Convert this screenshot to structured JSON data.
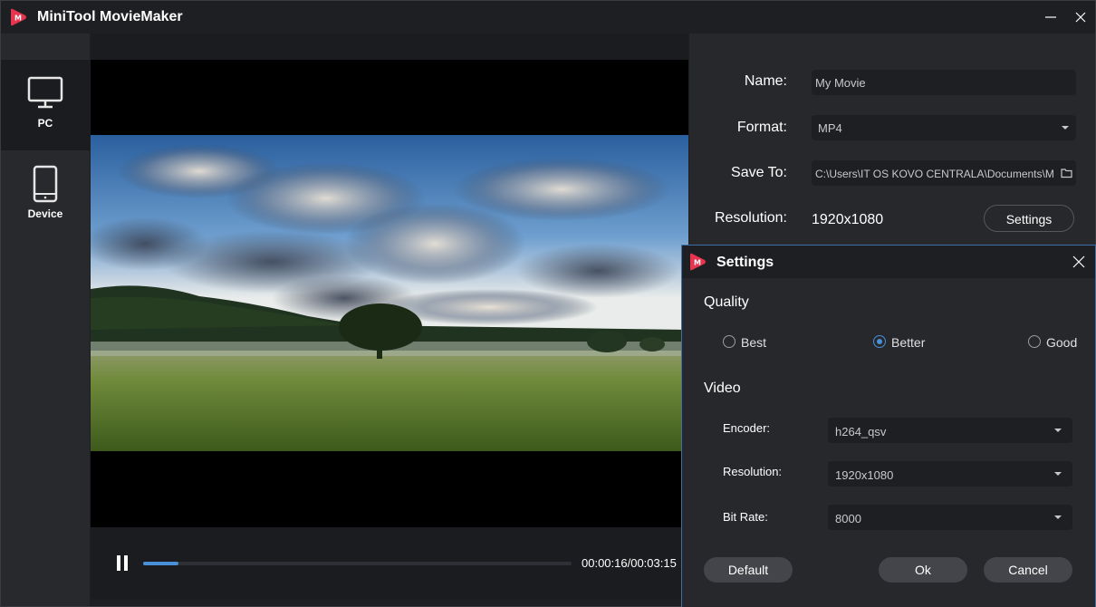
{
  "app": {
    "title": "MiniTool MovieMaker"
  },
  "sidebar": {
    "items": [
      {
        "label": "PC",
        "icon": "monitor-icon",
        "selected": true
      },
      {
        "label": "Device",
        "icon": "phone-icon",
        "selected": false
      }
    ]
  },
  "player": {
    "time": "00:00:16/00:03:15",
    "progress_fraction": 0.082
  },
  "export": {
    "name_label": "Name:",
    "name_value": "My Movie",
    "format_label": "Format:",
    "format_value": "MP4",
    "save_to_label": "Save To:",
    "save_to_value": "C:\\Users\\IT OS KOVO CENTRALA\\Documents\\M",
    "resolution_label": "Resolution:",
    "resolution_value": "1920x1080",
    "settings_button": "Settings"
  },
  "dialog": {
    "title": "Settings",
    "quality_title": "Quality",
    "quality_options": [
      {
        "label": "Best",
        "checked": false
      },
      {
        "label": "Better",
        "checked": true
      },
      {
        "label": "Good",
        "checked": false
      }
    ],
    "video_title": "Video",
    "encoder_label": "Encoder:",
    "encoder_value": "h264_qsv",
    "resolution_label": "Resolution:",
    "resolution_value": "1920x1080",
    "bitrate_label": "Bit Rate:",
    "bitrate_value": "8000",
    "default_button": "Default",
    "ok_button": "Ok",
    "cancel_button": "Cancel"
  },
  "colors": {
    "accent": "#4a90d9",
    "logo": "#e8344e",
    "background": "#1e1f22",
    "panel": "#27282c"
  }
}
